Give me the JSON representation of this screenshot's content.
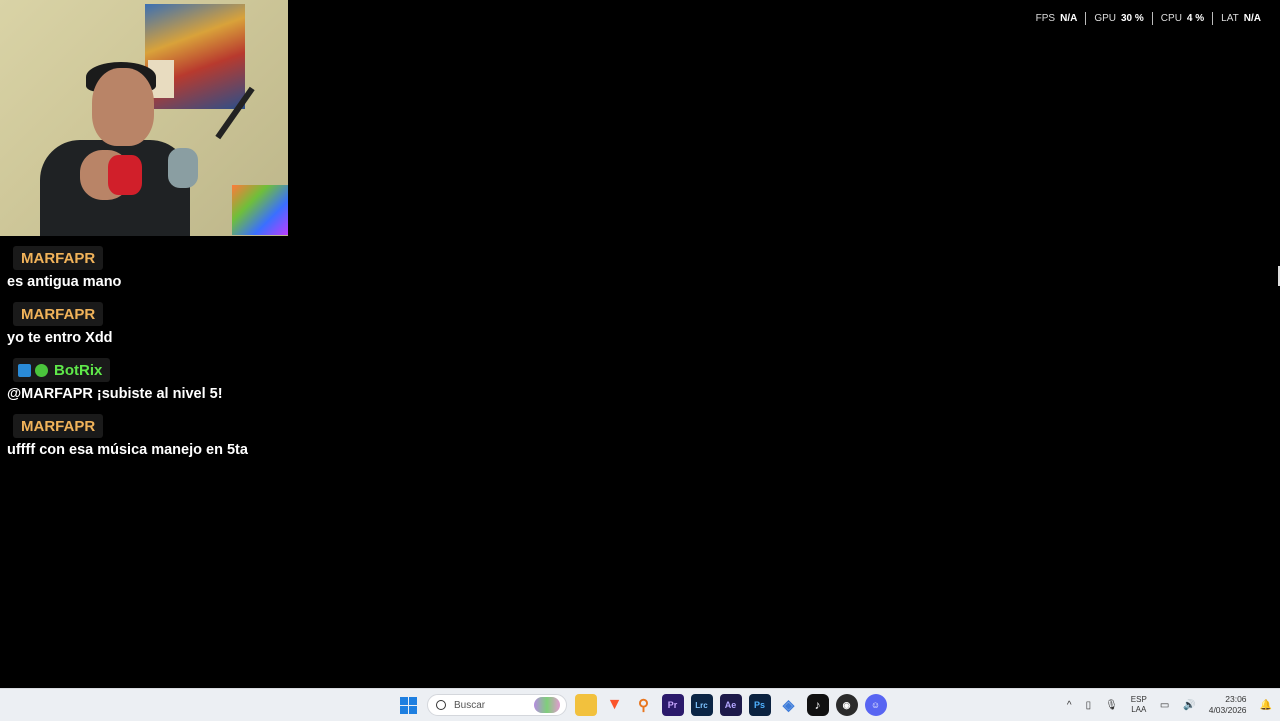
{
  "stats": [
    {
      "key": "FPS",
      "value": "N/A"
    },
    {
      "key": "GPU",
      "value": "30 %"
    },
    {
      "key": "CPU",
      "value": "4 %"
    },
    {
      "key": "LAT",
      "value": "N/A"
    }
  ],
  "chat": [
    {
      "user": "MARFAPR",
      "color": "#f1b35a",
      "text": "es antigua mano"
    },
    {
      "user": "MARFAPR",
      "color": "#f1b35a",
      "text": "yo te entro Xdd"
    },
    {
      "user": "BotRix",
      "color": "#5fe84a",
      "text": "@MARFAPR ¡subiste al nivel 5!"
    },
    {
      "user": "MARFAPR",
      "color": "#f1b35a",
      "text": "uffff con esa música manejo en 5ta"
    }
  ],
  "taskbar": {
    "search_placeholder": "Buscar",
    "apps": [
      {
        "label": "Pr",
        "color": "#2b1a6b",
        "fg": "#c9a7ff"
      },
      {
        "label": "Lrc",
        "color": "#0b2545",
        "fg": "#7fc4ff"
      },
      {
        "label": "Ae",
        "color": "#1d1a4a",
        "fg": "#b3a6ff"
      },
      {
        "label": "Ps",
        "color": "#0b2240",
        "fg": "#4fb1ff"
      }
    ],
    "lang_top": "ESP",
    "lang_bottom": "LAA",
    "time": "23:06",
    "date": "4/03/2026"
  }
}
